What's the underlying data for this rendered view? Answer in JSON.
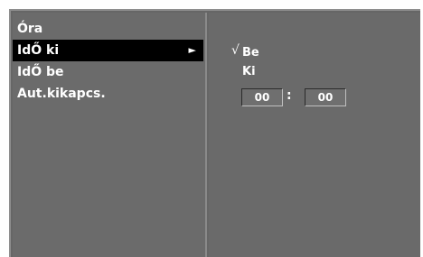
{
  "menu": {
    "items": [
      {
        "label": "Óra"
      },
      {
        "label": "IdŐ ki"
      },
      {
        "label": "IdŐ be"
      },
      {
        "label": "Aut.kikapcs."
      }
    ],
    "selected_arrow": "►"
  },
  "submenu": {
    "check_mark": "√",
    "options": [
      {
        "label": "Be",
        "checked": true
      },
      {
        "label": "Ki",
        "checked": false
      }
    ],
    "time": {
      "hours": "00",
      "separator": ":",
      "minutes": "00"
    }
  },
  "colors": {
    "panel": "#6b6b6b",
    "selected": "#000000",
    "text": "#ffffff"
  }
}
